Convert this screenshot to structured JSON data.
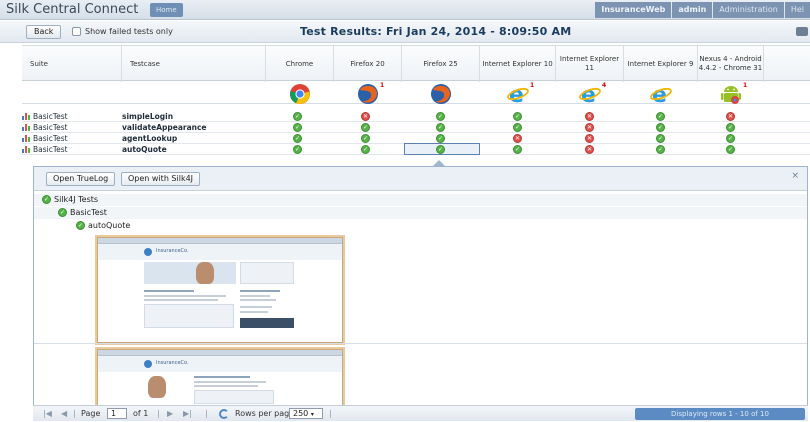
{
  "app": {
    "title": "Silk Central Connect",
    "home_tab": "Home"
  },
  "topnav": {
    "items": [
      "InsuranceWeb",
      "admin",
      "Administration",
      "Hel"
    ]
  },
  "toolbar": {
    "back_label": "Back",
    "show_failed_label": "Show failed tests only",
    "title": "Test Results: Fri Jan 24, 2014 - 8:09:50 AM"
  },
  "table": {
    "headers": {
      "suite": "Suite",
      "testcase": "Testcase"
    },
    "browsers": [
      {
        "label": "Chrome",
        "icon": "chrome-icon",
        "badge": ""
      },
      {
        "label": "Firefox 20",
        "icon": "firefox-icon",
        "badge": "1"
      },
      {
        "label": "Firefox 25",
        "icon": "firefox-icon",
        "badge": ""
      },
      {
        "label": "Internet Explorer 10",
        "icon": "internet-explorer-icon",
        "badge": "1"
      },
      {
        "label": "Internet Explorer 11",
        "icon": "internet-explorer-icon",
        "badge": "4"
      },
      {
        "label": "Internet Explorer 9",
        "icon": "internet-explorer-icon",
        "badge": ""
      },
      {
        "label": "Nexus 4 - Android 4.4.2 - Chrome 31",
        "icon": "android-chrome-icon",
        "badge": "1"
      }
    ],
    "rows": [
      {
        "suite": "BasicTest",
        "testcase": "simpleLogin",
        "results": [
          "pass",
          "fail",
          "pass",
          "pass",
          "fail",
          "pass",
          "fail"
        ]
      },
      {
        "suite": "BasicTest",
        "testcase": "validateAppearance",
        "results": [
          "pass",
          "pass",
          "pass",
          "pass",
          "fail",
          "pass",
          "pass"
        ]
      },
      {
        "suite": "BasicTest",
        "testcase": "agentLookup",
        "results": [
          "pass",
          "pass",
          "pass",
          "fail",
          "fail",
          "pass",
          "pass"
        ]
      },
      {
        "suite": "BasicTest",
        "testcase": "autoQuote",
        "results": [
          "pass",
          "pass",
          "pass",
          "pass",
          "fail",
          "pass",
          "pass"
        ]
      }
    ]
  },
  "panel": {
    "open_truelog": "Open TrueLog",
    "open_silk4j": "Open with Silk4J",
    "close": "×",
    "tree": [
      "Silk4J Tests",
      "BasicTest",
      "autoQuote"
    ],
    "screenshot_brand": "InsuranceCo."
  },
  "pager": {
    "page_label": "Page",
    "page_value": "1",
    "of_label": "of 1",
    "rows_per_page_label": "Rows per page",
    "rows_per_page_value": "250",
    "display_label": "Displaying rows 1 - 10 of 10"
  },
  "colors": {
    "pass": "#55b347",
    "fail": "#e0514a",
    "accent": "#5c8bc4"
  }
}
